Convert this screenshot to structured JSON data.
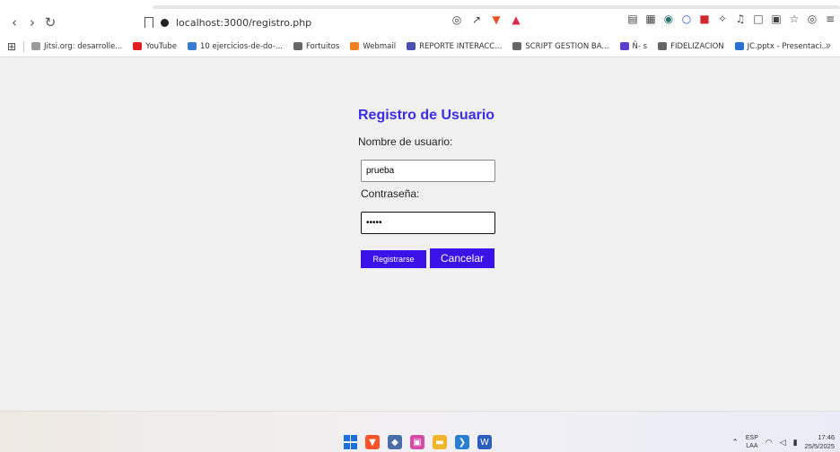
{
  "browser": {
    "url": "localhost:3000/registro.php",
    "bookmarks": [
      {
        "label": "Jitsi.org: desarrolle...",
        "color": "#9a9a9a"
      },
      {
        "label": "YouTube",
        "color": "#e02020"
      },
      {
        "label": "10 ejercicios-de-do-...",
        "color": "#3a7bd5"
      },
      {
        "label": "Fortuitos",
        "color": "#666666"
      },
      {
        "label": "Webmail",
        "color": "#f08020"
      },
      {
        "label": "REPORTE INTERACC...",
        "color": "#4a4fb0"
      },
      {
        "label": "SCRIPT GESTION BA...",
        "color": "#666666"
      },
      {
        "label": "Ñ- s",
        "color": "#5a3fd0"
      },
      {
        "label": "FIDELIZACION",
        "color": "#666666"
      },
      {
        "label": "JC.pptx - Presentaci...",
        "color": "#2a70d8"
      }
    ],
    "more_label": "»"
  },
  "form": {
    "title": "Registro de Usuario",
    "username_label": "Nombre de usuario:",
    "username_value": "prueba",
    "password_label": "Contraseña:",
    "password_value": "•••••",
    "register_label": "Registrarse",
    "cancel_label": "Cancelar"
  },
  "taskbar": {
    "lang_line1": "ESP",
    "lang_line2": "LAA",
    "time": "17:46",
    "date": "25/5/2025"
  },
  "colors": {
    "accent": "#3b13e8",
    "title": "#3b2ee6"
  }
}
